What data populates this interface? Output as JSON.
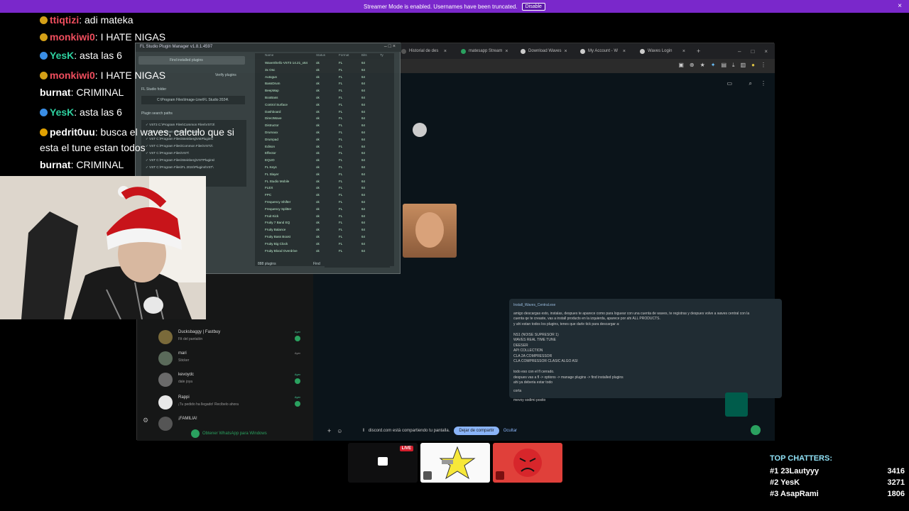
{
  "banner": {
    "text": "Streamer Mode is enabled. Usernames have been truncated.",
    "button": "Disable",
    "close": "×"
  },
  "chat": {
    "lines": [
      {
        "user": "ttiqtizi",
        "msg": ": adi mateka",
        "color": "#f04e5e"
      },
      {
        "user": "monkiwi0",
        "msg": ": I HATE NIGAS",
        "color": "#f04e5e"
      },
      {
        "user": "YesK",
        "msg": ": asta las 6",
        "color": "#2ed1a0"
      },
      {
        "user": "monkiwi0",
        "msg": ": I HATE NIGAS",
        "color": "#f04e5e"
      },
      {
        "user": "burnat",
        "msg": ": CRIMINAL",
        "color": "#ffffff"
      },
      {
        "user": "YesK",
        "msg": ": asta las 6",
        "color": "#2ed1a0"
      },
      {
        "user": "pedrit0uu",
        "msg": ": busca el waves, calculo que si",
        "color": "#ffffff"
      },
      {
        "user": "",
        "msg": "esta el tune estan todos",
        "color": "#ffffff"
      },
      {
        "user": "burnat",
        "msg": ": CRIMINAL",
        "color": "#ffffff"
      }
    ]
  },
  "browser": {
    "tabs": [
      {
        "label": "Historial de des",
        "color": "#3a3a3a"
      },
      {
        "label": "matesapp Stream",
        "color": "#2aa15f"
      },
      {
        "label": "Download Waves",
        "color": "#cccccc"
      },
      {
        "label": "My Account - W",
        "color": "#cccccc"
      },
      {
        "label": "Waves Login",
        "color": "#cccccc"
      }
    ],
    "new_tab": "+"
  },
  "plugin_manager": {
    "title": "FL Studio Plugin Manager v1.8.1.4597",
    "find_btn": "Find installed plugins",
    "verify": "Verify plugins",
    "folder_label": "FL Studio folder",
    "folder_path": "C:\\Program Files\\Image-Line\\FL Studio 2024\\",
    "search_label": "Plugin search paths",
    "paths": [
      "VST3  C:\\Program Files\\Common Files\\VST3\\",
      "VST   C:\\Program Files\\VSTPlugins\\",
      "VST   C:\\Program Files\\Steinberg\\VstPlugins\\",
      "VST   C:\\Program Files\\Common Files\\VST2\\",
      "VST   C:\\Program Files\\VST\\",
      "VST   C:\\Program Files\\Steinberg\\VSTPlugins\\",
      "VST   C:\\Program Files\\FL 2024\\Plugins\\VST\\"
    ],
    "headers": [
      "Name",
      "Status",
      "Format",
      "Bits",
      "Ty"
    ],
    "rows": [
      "WaveShell1-VST3 14.21_x64",
      "3x Osc",
      "Autogun",
      "BassDrum",
      "BeepMap",
      "BooBass",
      "Control Surface",
      "Dashboard",
      "DirectWave",
      "Distructor",
      "Drumaxx",
      "Drumpad",
      "Edison",
      "Effector",
      "EQUO",
      "FL Keys",
      "FL Slayer",
      "FL Studio Mobile",
      "FLEX",
      "FPC",
      "Frequency Shifter",
      "Frequency Splitter",
      "Fruit Kick",
      "Fruity 7 Band EQ",
      "Fruity Balance",
      "Fruity Bass Boost",
      "Fruity Big Clock",
      "Fruity Blood Overdrive"
    ],
    "row_status": "ok",
    "row_format": "FL",
    "row_bits": "64",
    "plugin_count": "888 plugins",
    "find_label": "Find"
  },
  "whatsapp": {
    "chats": [
      {
        "name": "Ducksbaggy | Fastbuy",
        "msg": "Fit del pantalón",
        "time": "Ayer"
      },
      {
        "name": "mari",
        "msg": "Sticker",
        "time": "Ayer"
      },
      {
        "name": "kevoydc",
        "msg": "dale joya",
        "time": "Ayer"
      },
      {
        "name": "Rappi",
        "msg": "¡Tu pedido ha llegado! Recíbelo ahora",
        "time": "Ayer"
      },
      {
        "name": "¡FAMILIA!",
        "msg": "",
        "time": ""
      }
    ],
    "get_app": "Obtener WhatsApp para Windows",
    "attachment": "Install_Waves_Central.exe",
    "message_lines": [
      "amigo descargas esto, instalas, despues te aparece como para loguear con una cuenta de waves, te registras y despues volve a waves central con la",
      "cuenta qe te creaste, vas a install products en la izquierda, aparece por ahi ALL PRODUCTS.",
      "y ahi estan todos los plugins, tenes que darle tick para descargar a:",
      "",
      "NS1 (NOISE SUPRESOR 1)",
      "WAVES REAL TIME TUNE",
      "DEESER",
      "API COLLECTION",
      "CLA 2A COMPRESSOR",
      "CLA COMPRESSOR CLASIC ALGO ASI",
      "",
      "todo eso con el fl cerrado.",
      "despues vas a fl -> options -> manage plugins -> find installed plugins",
      "ahi ya deberia estar todo"
    ],
    "reply1": "corta",
    "reply2": "mevoy sodimi postio",
    "share_text": "discord.com está compartiendo tu pantalla.",
    "stop_share": "Dejar de compartir",
    "hide": "Ocultar"
  },
  "stream_cards": {
    "live": "LIVE"
  },
  "top_chatters": {
    "title": "TOP CHATTERS:",
    "rows": [
      {
        "rank": "#1",
        "name": "23Lautyyy",
        "score": "3416"
      },
      {
        "rank": "#2",
        "name": "YesK",
        "score": "3271"
      },
      {
        "rank": "#3",
        "name": "AsapRami",
        "score": "1806"
      }
    ]
  }
}
